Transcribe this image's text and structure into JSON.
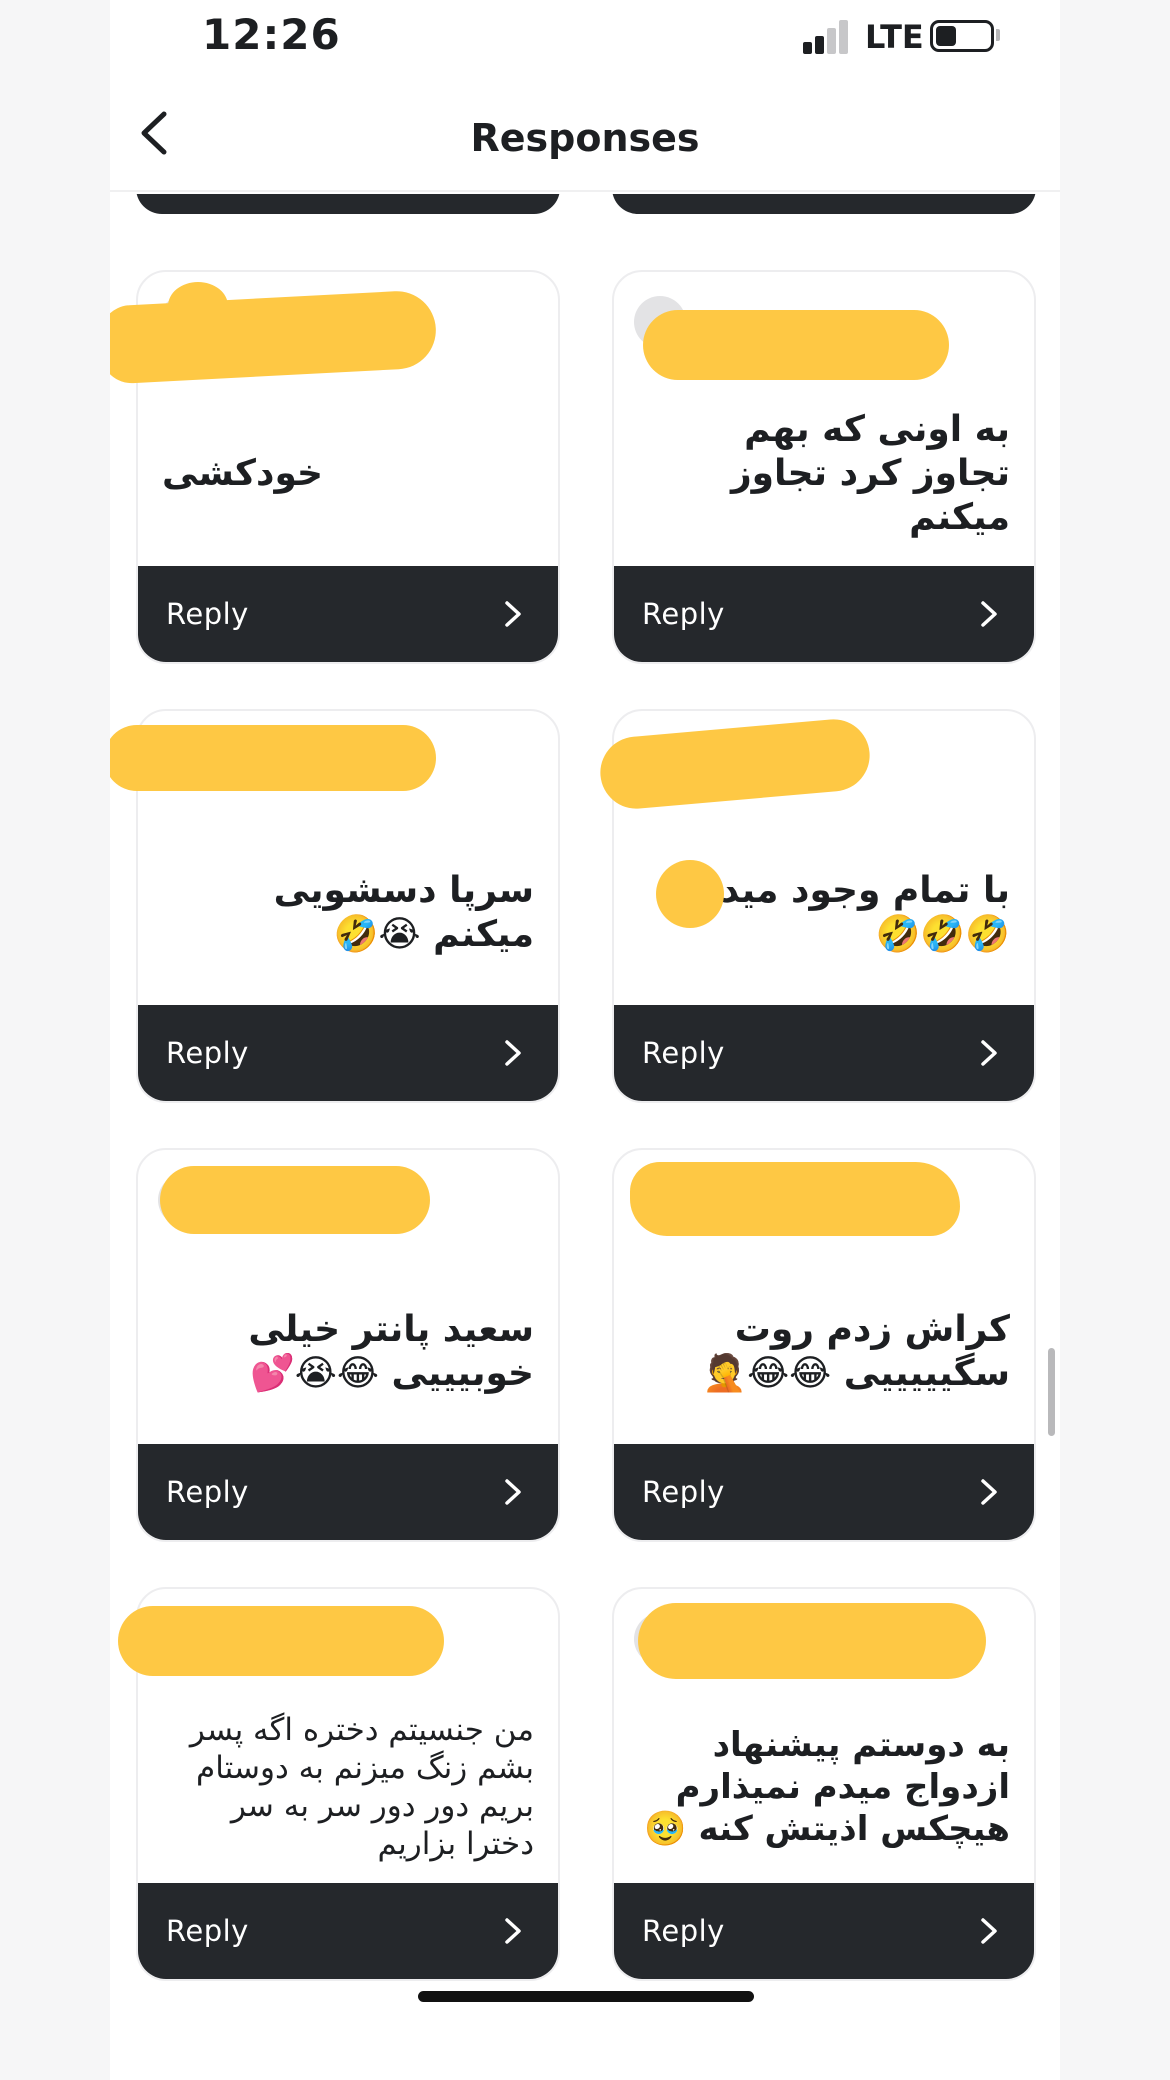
{
  "status_bar": {
    "time": "12:26",
    "network": "LTE"
  },
  "nav": {
    "title": "Responses"
  },
  "cards": [
    {
      "text": "خودکشی",
      "reply": "Reply"
    },
    {
      "text": "به اونی که بهم تجاوز کرد تجاوز میکنم",
      "reply": "Reply"
    },
    {
      "text": "سرپا دسشویی میکنم 😭🤣",
      "reply": "Reply"
    },
    {
      "text": "با تمام وجود میدم 🤣🤣🤣",
      "reply": "Reply"
    },
    {
      "text": "سعید پانتر خیلی خوبیییی 😂😭💕",
      "reply": "Reply"
    },
    {
      "text": "کراش زدم روت سگیییییی 😂😂🤦",
      "reply": "Reply"
    },
    {
      "text": "من جنسیتم دختره اگه پسر بشم زنگ میزنم به دوستام بریم دور دور سر به سر دخترا بزاریم",
      "reply": "Reply"
    },
    {
      "text": "به دوستم پیشنهاد ازدواج میدم نمیذارم هیچکس اذیتش کنه 🥹",
      "reply": "Reply"
    }
  ],
  "colors": {
    "accent_redaction": "#fec844",
    "reply_bar": "#25282c",
    "card_border": "#ededef"
  }
}
